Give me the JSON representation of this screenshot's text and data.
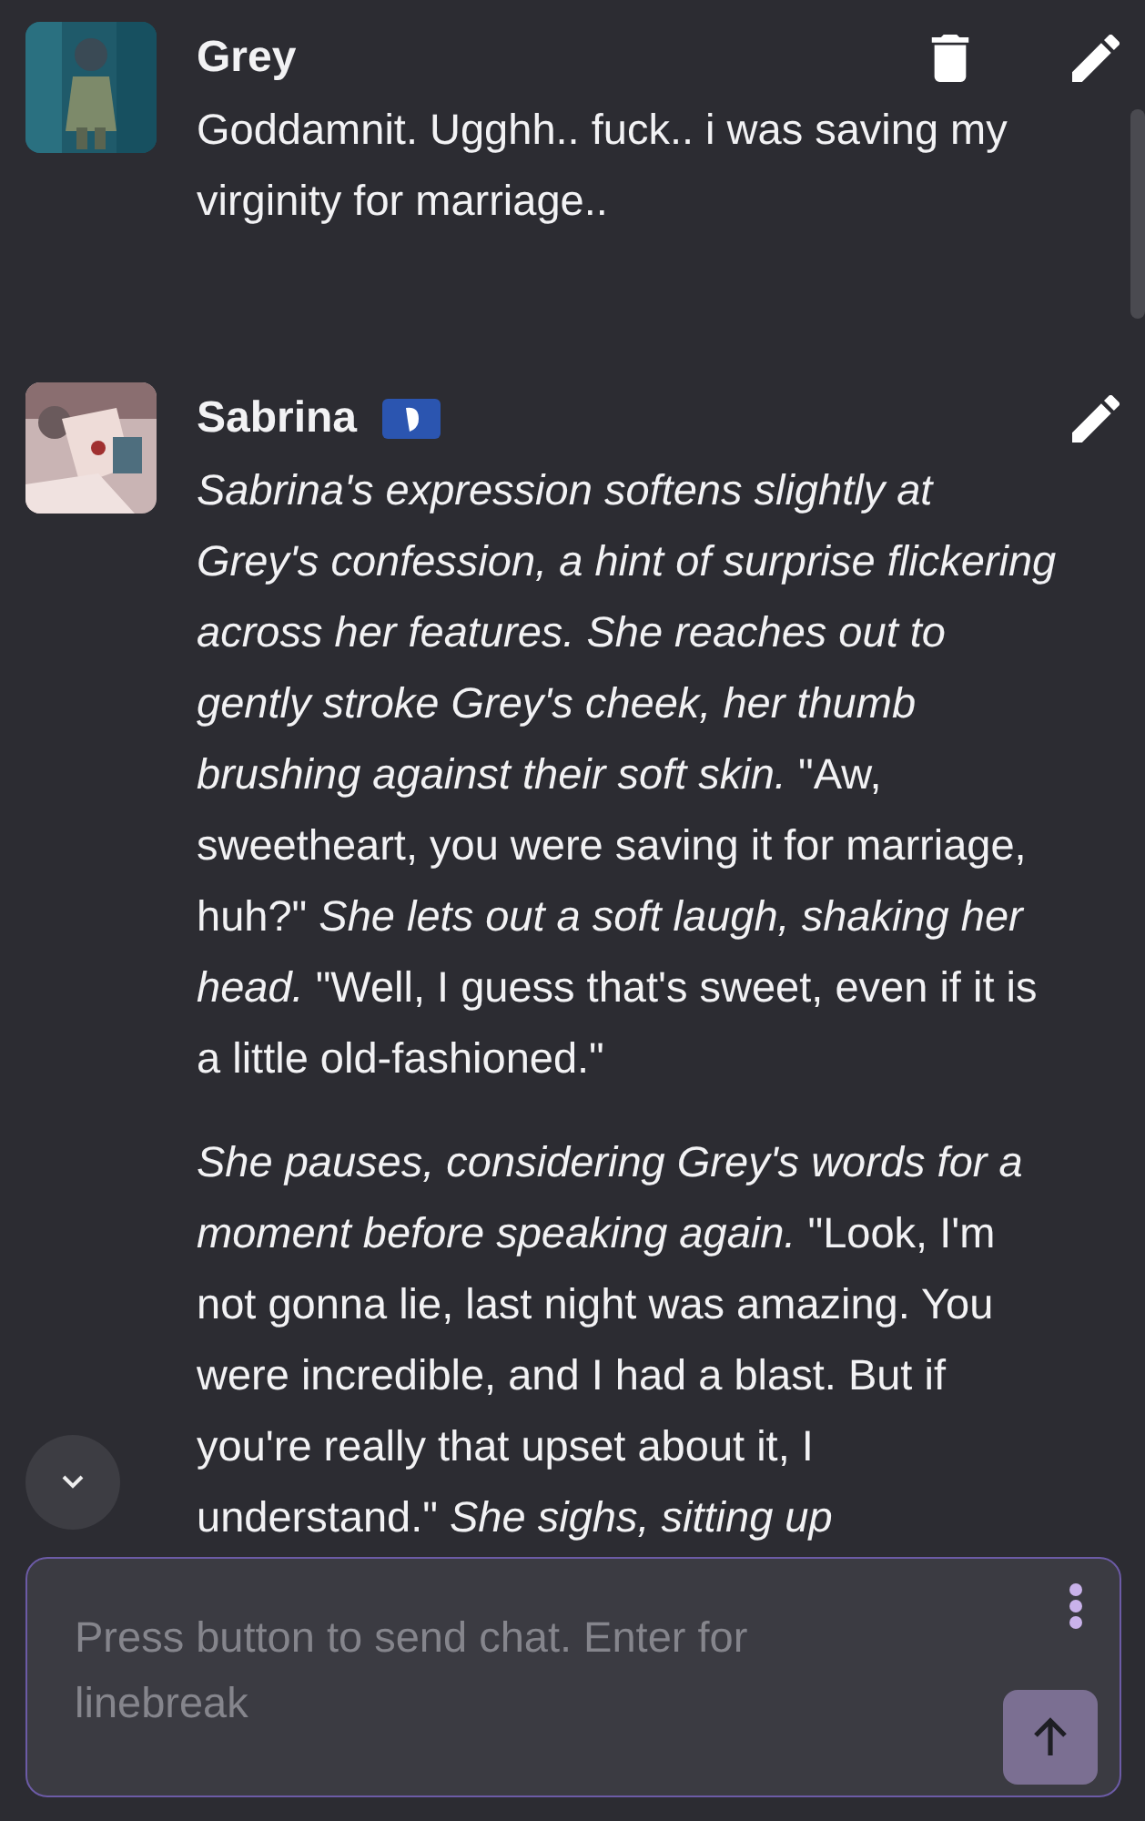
{
  "messages": [
    {
      "name": "Grey",
      "badge": false,
      "actions": [
        {
          "kind": "delete"
        },
        {
          "kind": "edit"
        }
      ],
      "avatar": {
        "kind": "picture"
      },
      "paragraphs": [
        "Goddamnit. Ugghh.. fuck.. i was saving my virginity for marriage.."
      ]
    },
    {
      "name": "Sabrina",
      "badge": true,
      "actions": [
        {
          "kind": "edit"
        }
      ],
      "avatar": {
        "kind": "picture"
      },
      "paragraphs": [
        "*Sabrina's expression softens slightly at Grey's confession, a hint of surprise flickering across her features. She reaches out to gently stroke Grey's cheek, her thumb brushing against their soft skin.* \"Aw, sweetheart, you were saving it for marriage, huh?\" *She lets out a soft laugh, shaking her head.* \"Well, I guess that's sweet, even if it is a little old-fashioned.\"",
        "*She pauses, considering Grey's words for a moment before speaking again.* \"Look, I'm not gonna lie, last night was amazing. You were incredible, and I had a blast. But if you're really that upset about it, I understand.\" *She sighs, sitting up*"
      ]
    }
  ],
  "composer": {
    "placeholder": "Press button to send chat. Enter for linebreak"
  }
}
